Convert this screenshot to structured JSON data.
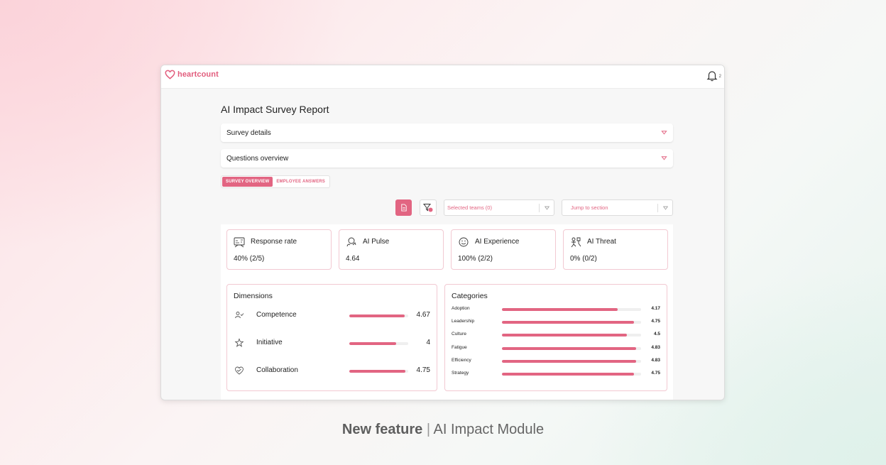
{
  "app": {
    "logo_text": "heartcount",
    "notification_count": "2"
  },
  "report": {
    "title": "AI Impact Survey Report"
  },
  "accordions": [
    {
      "label": "Survey details"
    },
    {
      "label": "Questions overview"
    }
  ],
  "tabs": [
    {
      "label": "SURVEY OVERVIEW",
      "active": true
    },
    {
      "label": "EMPLOYEE ANSWERS",
      "active": false
    }
  ],
  "toolbar": {
    "filter_badge": "1",
    "teams_dropdown": "Selected teams (0)",
    "jump_dropdown": "Jump to section"
  },
  "kpis": [
    {
      "label": "Response rate",
      "value": "40% (2/5)",
      "icon": "response-rate-icon"
    },
    {
      "label": "AI Pulse",
      "value": "4.64",
      "icon": "ai-pulse-icon"
    },
    {
      "label": "AI Experience",
      "value": "100% (2/2)",
      "icon": "smiley-icon"
    },
    {
      "label": "AI Threat",
      "value": "0% (0/2)",
      "icon": "ai-threat-icon"
    }
  ],
  "dimensions": {
    "title": "Dimensions",
    "max": 5,
    "items": [
      {
        "label": "Competence",
        "value": 4.67,
        "display": "4.67",
        "icon": "competence-icon"
      },
      {
        "label": "Initiative",
        "value": 4,
        "display": "4",
        "icon": "initiative-icon"
      },
      {
        "label": "Collaboration",
        "value": 4.75,
        "display": "4.75",
        "icon": "collaboration-icon"
      }
    ]
  },
  "categories": {
    "title": "Categories",
    "max": 5,
    "items": [
      {
        "label": "Adoption",
        "value": 4.17,
        "display": "4.17"
      },
      {
        "label": "Leadership",
        "value": 4.75,
        "display": "4.75"
      },
      {
        "label": "Culture",
        "value": 4.5,
        "display": "4.5"
      },
      {
        "label": "Fatigue",
        "value": 4.83,
        "display": "4.83"
      },
      {
        "label": "Efficiency",
        "value": 4.83,
        "display": "4.83"
      },
      {
        "label": "Strategy",
        "value": 4.75,
        "display": "4.75"
      }
    ]
  },
  "caption": {
    "bold": "New feature",
    "separator": "|",
    "rest": "AI Impact Module"
  },
  "colors": {
    "accent": "#e26582",
    "track": "#efefef",
    "card_border": "#f2c9d2"
  }
}
